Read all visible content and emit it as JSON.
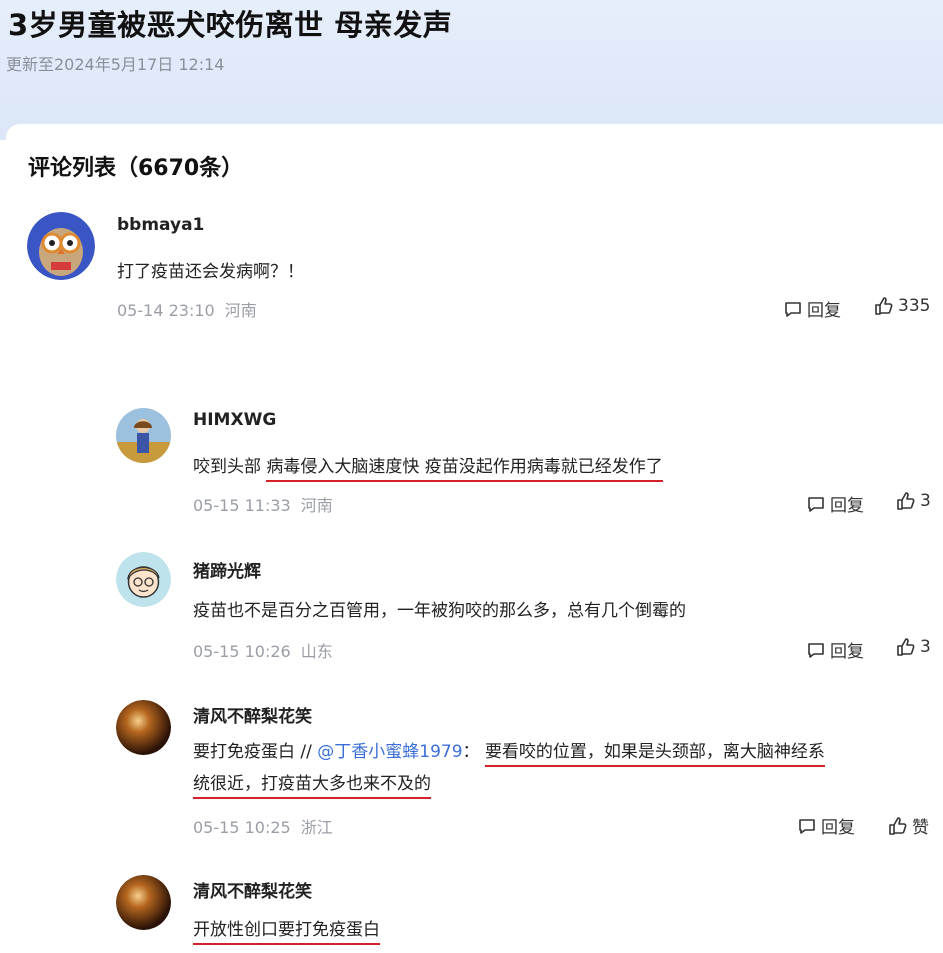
{
  "article": {
    "title": "3岁男童被恶犬咬伤离世 母亲发声",
    "updated": "更新至2024年5月17日 12:14"
  },
  "comments_header": "评论列表（6670条）",
  "comments": [
    {
      "user": "bbmaya1",
      "text": "打了疫苗还会发病啊？！",
      "date": "05-14 23:10",
      "location": "河南",
      "reply_label": "回复",
      "likes": "335"
    },
    {
      "user": "HIMXWG",
      "text_plain": "咬到头部",
      "text_underlined": "病毒侵入大脑速度快 疫苗没起作用病毒就已经发作了",
      "date": "05-15 11:33",
      "location": "河南",
      "reply_label": "回复",
      "likes": "3"
    },
    {
      "user": "猪蹄光辉",
      "text": "疫苗也不是百分之百管用，一年被狗咬的那么多，总有几个倒霉的",
      "date": "05-15 10:26",
      "location": "山东",
      "reply_label": "回复",
      "likes": "3"
    },
    {
      "user": "清风不醉梨花笑",
      "text_prefix": "要打免疫蛋白 // ",
      "mention": "@丁香小蜜蜂1979",
      "text_colon": "： ",
      "text_underlined_1": "要看咬的位置，如果是头颈部，离大脑神经系",
      "text_underlined_2": "统很近，打疫苗大多也来不及的",
      "date": "05-15 10:25",
      "location": "浙江",
      "reply_label": "回复",
      "like_label": "赞"
    },
    {
      "user": "清风不醉梨花笑",
      "text_underlined": "开放性创口要打免疫蛋白"
    }
  ],
  "colors": {
    "underline": "#d6202a",
    "mention": "#3b6fd8",
    "header_bg": "#e6eefb"
  },
  "icons": [
    "comment-bubble-icon",
    "thumbs-up-icon"
  ]
}
